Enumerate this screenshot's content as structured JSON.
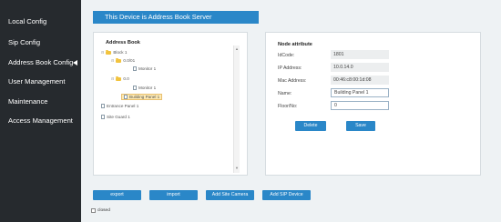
{
  "sidebar": {
    "items": [
      {
        "label": "Local Config"
      },
      {
        "label": "Sip Config"
      },
      {
        "label": "Address Book Config"
      },
      {
        "label": "User Management"
      },
      {
        "label": "Maintenance"
      },
      {
        "label": "Access Management"
      }
    ],
    "active_index": 2
  },
  "header": {
    "title": "This Device is Address Book Server"
  },
  "address_book": {
    "title": "Address Book",
    "tree": [
      {
        "label": "Block 1",
        "kind": "folder",
        "toggle": "⊟"
      },
      {
        "label": "0.0/01",
        "kind": "folder",
        "toggle": "⊟"
      },
      {
        "label": "Monitor 1",
        "kind": "device"
      },
      {
        "label": "0.0",
        "kind": "folder",
        "toggle": "⊟"
      },
      {
        "label": "Monitor 1",
        "kind": "device"
      },
      {
        "label": "Building Panel 1",
        "kind": "device",
        "selected": true
      },
      {
        "label": "Entrance Panel 1",
        "kind": "device"
      },
      {
        "label": "Site Guard 1",
        "kind": "device"
      }
    ]
  },
  "node_attribute": {
    "title": "Node attribute",
    "fields": [
      {
        "label": "IdCode:",
        "value": "1801",
        "editable": false
      },
      {
        "label": "IP Address:",
        "value": "10.0.14.0",
        "editable": false
      },
      {
        "label": "Mac Address:",
        "value": "00:46:c8:00:1d:08",
        "editable": false
      },
      {
        "label": "Name:",
        "value": "Building Panel 1",
        "editable": true
      },
      {
        "label": "Floor/No:",
        "value": "0",
        "editable": true
      }
    ],
    "delete_label": "Delete",
    "save_label": "Save"
  },
  "toolbar": {
    "export_label": "export",
    "import_label": "import",
    "add_site_camera_label": "Add Site Camera",
    "add_sip_device_label": "Add SIP Device"
  },
  "closed_checkbox": {
    "label": "closed",
    "checked": false
  },
  "colors": {
    "accent": "#2a87c8",
    "sidebar_bg": "#262a2e",
    "page_bg": "#eef2f4"
  }
}
